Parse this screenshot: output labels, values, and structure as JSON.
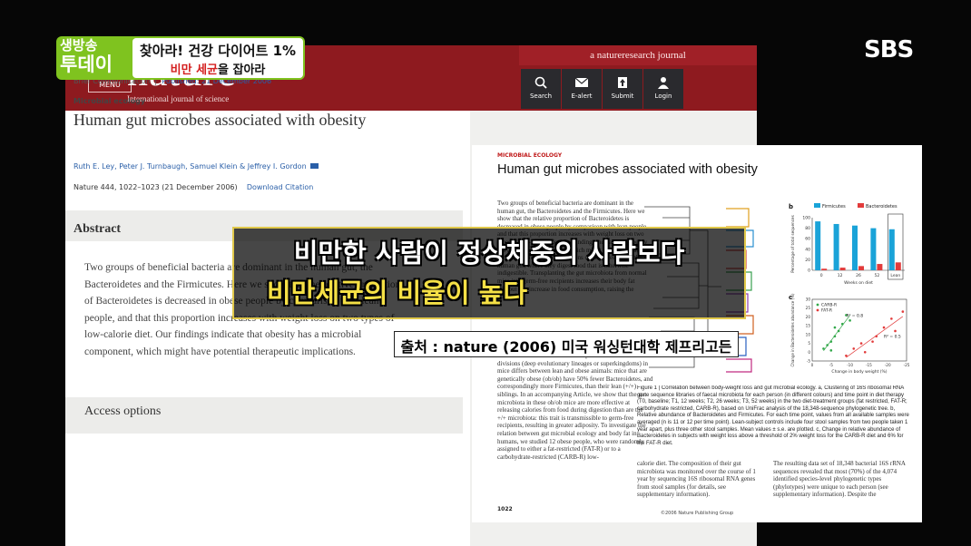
{
  "broadcast": {
    "program_small": "생방송",
    "program_big": "투데이",
    "headline_line1": "찾아라! 건강 다이어트 1%",
    "headline_line2_red": "비만 세균",
    "headline_line2_rest": "을 잡아라",
    "channel_logo": "SBS",
    "caption_line1": "비만한 사람이 정상체중의 사람보다",
    "caption_line2": "비만세균의 비율이 높다",
    "source": "출처 : nature (2006) 미국 워싱턴대학 제프리고든",
    "colors": {
      "badge_green": "#7fc31f",
      "caption_yellow": "#f5e046",
      "headline_red": "#d42020"
    }
  },
  "website": {
    "logo": "nature",
    "logo_sub": "International journal of science",
    "menu_label": "MENU",
    "journal_label": "a natureresearch journal",
    "nav": [
      {
        "label": "Search",
        "icon": "search-icon"
      },
      {
        "label": "E-alert",
        "icon": "envelope-icon"
      },
      {
        "label": "Submit",
        "icon": "upload-icon"
      },
      {
        "label": "Login",
        "icon": "user-icon"
      }
    ],
    "article_type": "Brief Communication",
    "published": "Published: 21 December 2006",
    "section": "Microbial ecology",
    "title": "Human gut microbes associated with obesity",
    "authors": "Ruth E. Ley, Peter J. Turnbaugh, Samuel Klein & Jeffrey I. Gordon",
    "citation": "Nature 444, 1022–1023 (21 December 2006)",
    "download_label": "Download Citation",
    "abstract_heading": "Abstract",
    "abstract_text": "Two groups of beneficial bacteria are dominant in the human gut, the Bacteroidetes and the Firmicutes. Here we show that the relative proportion of Bacteroidetes is decreased in obese people by comparison with lean people, and that this proportion increases with weight loss on two types of low-calorie diet. Our findings indicate that obesity has a microbial component, which might have potential therapeutic implications.",
    "access_heading": "Access options",
    "colors": {
      "header_red": "#8e1a1f"
    }
  },
  "paper": {
    "section_label": "MICROBIAL ECOLOGY",
    "title": "Human gut microbes associated with obesity",
    "col1_top": "Two groups of beneficial bacteria are dominant in the human gut, the Bacteroidetes and the Firmicutes. Here we show that the relative proportion of Bacteroidetes is decreased in obese people by comparison with lean people, and that this proportion increases with weight loss on two types of low-calorie diet. Our findings indicate that obesity has a microbial component, which might have potential therapeutic implications. Trillions of microbes live in the human gut, where they digest food that is otherwise indigestible. Transplanting the gut microbiota from normal mice into germ-free recipients increases their body fat without any increase in food consumption, raising the possibility",
    "col1_bottom": "The relative abundance of the two predominant bacterial divisions (deep evolutionary lineages or superkingdoms) in mice differs between lean and obese animals: mice that are genetically obese (ob/ob) have 50% fewer Bacteroidetes, and correspondingly more Firmicutes, than their lean (+/+) siblings. In an accompanying Article, we show that the gut microbiota in these ob/ob mice are more effective at releasing calories from food during digestion than are the +/+ microbiota: this trait is transmissible to germ-free recipients, resulting in greater adiposity. To investigate the relation between gut microbial ecology and body fat in humans, we studied 12 obese people, who were randomly assigned to either a fat-restricted (FAT-R) or to a carbohydrate-restricted (CARB-R) low-",
    "figure_caption": "Figure 1 | Correlation between body-weight loss and gut microbial ecology. a, Clustering of 16S ribosomal RNA gene sequence libraries of faecal microbiota for each person (in different colours) and time point in diet therapy (T0, baseline; T1, 12 weeks; T2, 26 weeks; T3, 52 weeks) in the two diet-treatment groups (fat restricted, FAT-R; carbohydrate restricted, CARB-R), based on UniFrac analysis of the 18,348-sequence phylogenetic tree. b, Relative abundance of Bacteroidetes and Firmicutes. For each time point, values from all available samples were averaged (n is 11 or 12 per time point). Lean-subject controls include four stool samples from two people taken 1 year apart, plus three other stool samples. Mean values ± s.e. are plotted. c, Change in relative abundance of Bacteroidetes in subjects with weight loss above a threshold of 2% weight loss for the CARB-R diet and 6% for the FAT-R diet.",
    "col2": "calorie diet. The composition of their gut microbiota was monitored over the course of 1 year by sequencing 16S ribosomal RNA genes from stool samples (for details, see supplementary information).",
    "col3": "The resulting data set of 18,348 bacterial 16S rRNA sequences revealed that most (70%) of the 4,074 identified species-level phylogenetic types (phylotypes) were unique to each person (see supplementary information). Despite the",
    "page_number": "1022",
    "copyright": "©2006 Nature Publishing Group"
  },
  "chart_data": [
    {
      "type": "bar",
      "title": "b",
      "categories": [
        "0",
        "12",
        "26",
        "52",
        "Lean"
      ],
      "xlabel": "Weeks on diet",
      "ylabel": "Percentage of total sequences",
      "ylim": [
        0,
        100
      ],
      "ticks": [
        0,
        20,
        40,
        60,
        80,
        100
      ],
      "legend_position": "top",
      "series": [
        {
          "name": "Firmicutes",
          "color": "#1aa3d8",
          "values": [
            93,
            88,
            85,
            80,
            78
          ]
        },
        {
          "name": "Bacteroidetes",
          "color": "#e23b3b",
          "values": [
            3,
            5,
            8,
            12,
            15
          ]
        }
      ]
    },
    {
      "type": "scatter",
      "title": "c",
      "xlabel": "Change in body weight (%)",
      "ylabel": "Change in Bacteroidetes abundance (%)",
      "xlim": [
        0,
        -25
      ],
      "ylim": [
        -5,
        30
      ],
      "xticks": [
        0,
        -5,
        -10,
        -15,
        -20,
        -25
      ],
      "yticks": [
        -5,
        0,
        5,
        10,
        15,
        20,
        25,
        30
      ],
      "annotations": [
        "R² = 0.8",
        "R² = 0.5"
      ],
      "series": [
        {
          "name": "CARB-R",
          "color": "#33a84a",
          "points": [
            [
              -3,
              2
            ],
            [
              -4,
              4
            ],
            [
              -5,
              6
            ],
            [
              -6,
              9
            ],
            [
              -7,
              12
            ],
            [
              -8,
              16
            ],
            [
              -9,
              21
            ],
            [
              -5,
              1
            ],
            [
              -6,
              14
            ],
            [
              -10,
              18
            ]
          ]
        },
        {
          "name": "FAT-R",
          "color": "#e23b3b",
          "points": [
            [
              -9,
              -2
            ],
            [
              -11,
              2
            ],
            [
              -13,
              5
            ],
            [
              -14,
              0
            ],
            [
              -16,
              6
            ],
            [
              -17,
              9
            ],
            [
              -19,
              14
            ],
            [
              -21,
              19
            ],
            [
              -22,
              12
            ],
            [
              -24,
              23
            ]
          ]
        }
      ]
    }
  ]
}
